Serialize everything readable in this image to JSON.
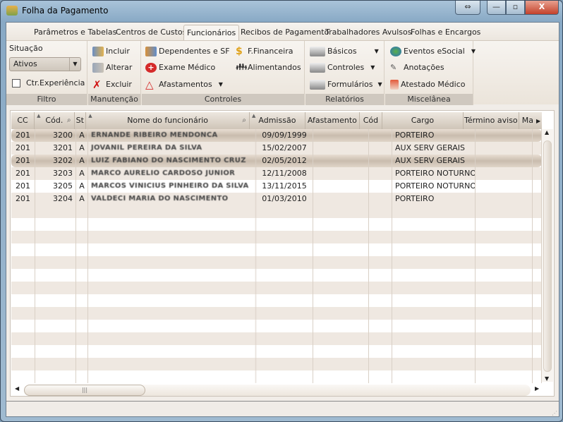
{
  "window": {
    "title": "Folha da Pagamento",
    "buttons": {
      "resize": "⇔",
      "minimize": "—",
      "maximize": "▫",
      "close": "X"
    }
  },
  "tabs": [
    "Parâmetros e Tabelas",
    "Centros de Custos",
    "Funcionários",
    "Recibos de Pagamento",
    "Trabalhadores Avulsos",
    "Folhas e Encargos"
  ],
  "active_tab": "Funcionários",
  "ribbon": {
    "filtro": {
      "label": "Filtro",
      "situacao_label": "Situação",
      "situacao_value": "Ativos",
      "ctr_experiencia": "Ctr.Experiência"
    },
    "manutencao": {
      "label": "Manutenção",
      "incluir": "Incluir",
      "alterar": "Alterar",
      "excluir": "Excluir"
    },
    "controles": {
      "label": "Controles",
      "dependentes": "Dependentes e SF",
      "exame": "Exame Médico",
      "afastamentos": "Afastamentos",
      "financeira": "F.Financeira",
      "alimentandos": "Alimentandos"
    },
    "relatorios": {
      "label": "Relatórios",
      "basicos": "Básicos",
      "controles": "Controles",
      "formularios": "Formulários"
    },
    "miscelanea": {
      "label": "Miscelânea",
      "esocial": "Eventos eSocial",
      "anotacoes": "Anotações",
      "atestado": "Atestado Médico"
    }
  },
  "grid": {
    "columns": [
      "CC",
      "Cód.",
      "St",
      "Nome do funcionário",
      "Admissão",
      "Afastamento",
      "Cód",
      "Cargo",
      "Término aviso",
      "Ma"
    ],
    "rows": [
      {
        "cc": "201",
        "cod": "3200",
        "st": "A",
        "nome": "ERNANDE RIBEIRO MENDONCA",
        "admissao": "09/09/1999",
        "afastamento": "",
        "cod2": "",
        "cargo": "PORTEIRO",
        "termino": ""
      },
      {
        "cc": "201",
        "cod": "3201",
        "st": "A",
        "nome": "JOVANIL PEREIRA DA SILVA",
        "admissao": "15/02/2007",
        "afastamento": "",
        "cod2": "",
        "cargo": "AUX SERV GERAIS",
        "termino": ""
      },
      {
        "cc": "201",
        "cod": "3202",
        "st": "A",
        "nome": "LUIZ FABIANO DO NASCIMENTO CRUZ",
        "admissao": "02/05/2012",
        "afastamento": "",
        "cod2": "",
        "cargo": "AUX SERV GERAIS",
        "termino": ""
      },
      {
        "cc": "201",
        "cod": "3203",
        "st": "A",
        "nome": "MARCO AURELIO CARDOSO JUNIOR",
        "admissao": "12/11/2008",
        "afastamento": "",
        "cod2": "",
        "cargo": "PORTEIRO NOTURNO",
        "termino": ""
      },
      {
        "cc": "201",
        "cod": "3205",
        "st": "A",
        "nome": "MARCOS VINICIUS PINHEIRO DA SILVA",
        "admissao": "13/11/2015",
        "afastamento": "",
        "cod2": "",
        "cargo": "PORTEIRO NOTURNO",
        "termino": ""
      },
      {
        "cc": "201",
        "cod": "3204",
        "st": "A",
        "nome": "VALDECI MARIA DO NASCIMENTO",
        "admissao": "01/03/2010",
        "afastamento": "",
        "cod2": "",
        "cargo": "PORTEIRO",
        "termino": ""
      }
    ]
  }
}
